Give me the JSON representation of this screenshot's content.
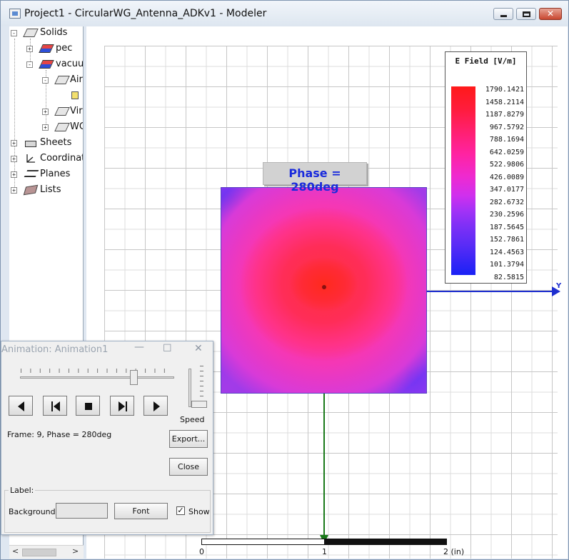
{
  "window": {
    "title": "Project1 - CircularWG_Antenna_ADKv1 - Modeler"
  },
  "tree": {
    "items": [
      {
        "label": "Solids",
        "expander": "-",
        "icon": "solid-icon"
      },
      {
        "label": "pec",
        "expander": "+",
        "icon": "material-pec-icon"
      },
      {
        "label": "vacuum",
        "expander": "-",
        "icon": "material-vacuum-icon"
      },
      {
        "label": "Air",
        "expander": "-",
        "icon": "solid-object-icon"
      },
      {
        "label": "",
        "expander": "",
        "icon": "cube-icon"
      },
      {
        "label": "Vir",
        "expander": "+",
        "icon": "solid-object-icon"
      },
      {
        "label": "WG",
        "expander": "+",
        "icon": "solid-object-icon"
      },
      {
        "label": "Sheets",
        "expander": "+",
        "icon": "sheet-icon"
      },
      {
        "label": "Coordinat",
        "expander": "+",
        "icon": "coordinate-icon"
      },
      {
        "label": "Planes",
        "expander": "+",
        "icon": "planes-icon"
      },
      {
        "label": "Lists",
        "expander": "+",
        "icon": "lists-icon"
      }
    ],
    "scroll_left": "<",
    "scroll_right": ">"
  },
  "viewport": {
    "phase_label": "Phase = 280deg",
    "axis_y_label": "Y",
    "scale": {
      "ticks": [
        "0",
        "1",
        "2 (in)"
      ]
    }
  },
  "legend": {
    "title": "E Field [V/m]",
    "values": [
      "1790.1421",
      "1458.2114",
      "1187.8279",
      "967.5792",
      "788.1694",
      "642.0259",
      "522.9806",
      "426.0089",
      "347.0177",
      "282.6732",
      "230.2596",
      "187.5645",
      "152.7861",
      "124.4563",
      "101.3794",
      "82.5815"
    ],
    "colors": {
      "max": "#ff1a1a",
      "min": "#1a22f5"
    }
  },
  "animation": {
    "title": "Animation: Animation1",
    "frame_status": "Frame: 9, Phase = 280deg",
    "speed_label": "Speed",
    "buttons": {
      "export": "Export...",
      "close": "Close",
      "font": "Font"
    },
    "label_group": "Label:",
    "background_label": "Background:",
    "show_label": "Show",
    "show_checked": "✓",
    "slider_value": 9,
    "slider_max": 12
  }
}
